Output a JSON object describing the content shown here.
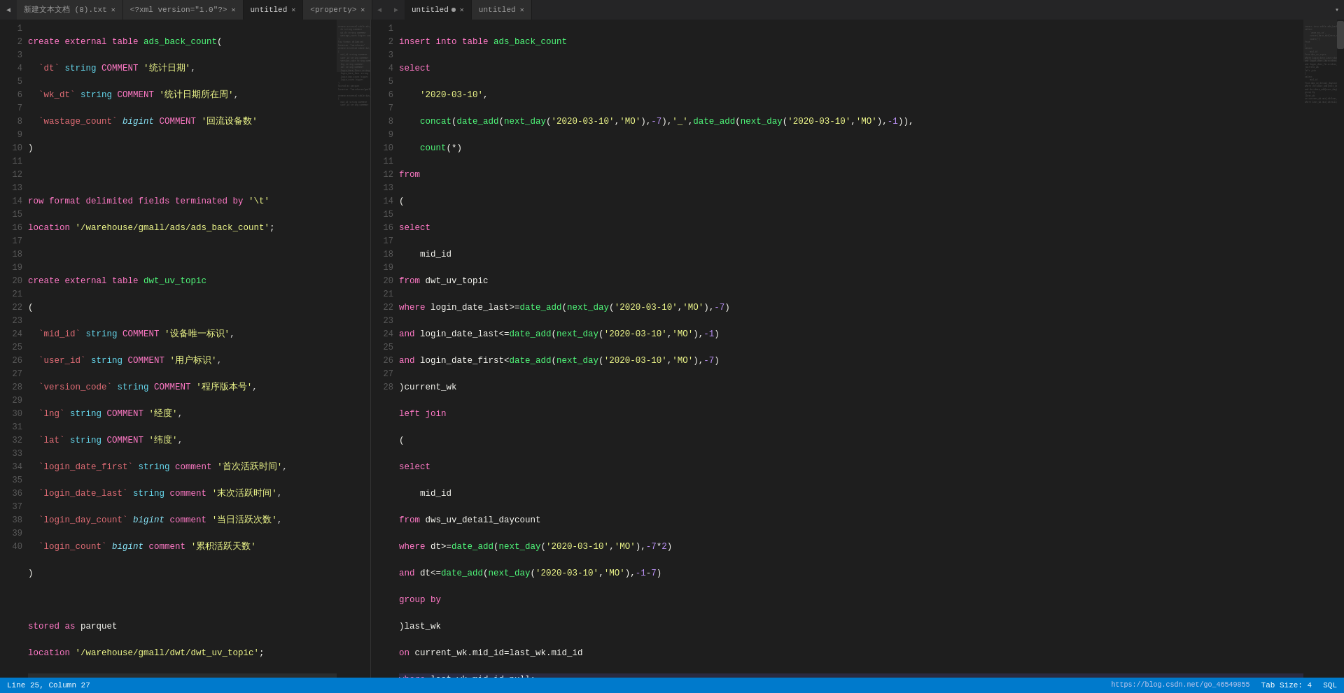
{
  "tabs_left": [
    {
      "label": "新建文本文档 (8).txt",
      "active": false,
      "modified": false
    },
    {
      "label": "<?xml version=\"1.0\"?>",
      "active": false,
      "modified": false
    },
    {
      "label": "untitled",
      "active": true,
      "modified": false
    },
    {
      "label": "<property>",
      "active": false,
      "modified": false
    }
  ],
  "tabs_right": [
    {
      "label": "untitled",
      "active": true,
      "modified": false
    },
    {
      "label": "untitled",
      "active": false,
      "modified": false
    }
  ],
  "status": {
    "left": "Line 25, Column 27",
    "tabSize": "Tab Size: 4",
    "lang": "SQL",
    "url": "https://blog.csdn.net/go_46549855"
  }
}
